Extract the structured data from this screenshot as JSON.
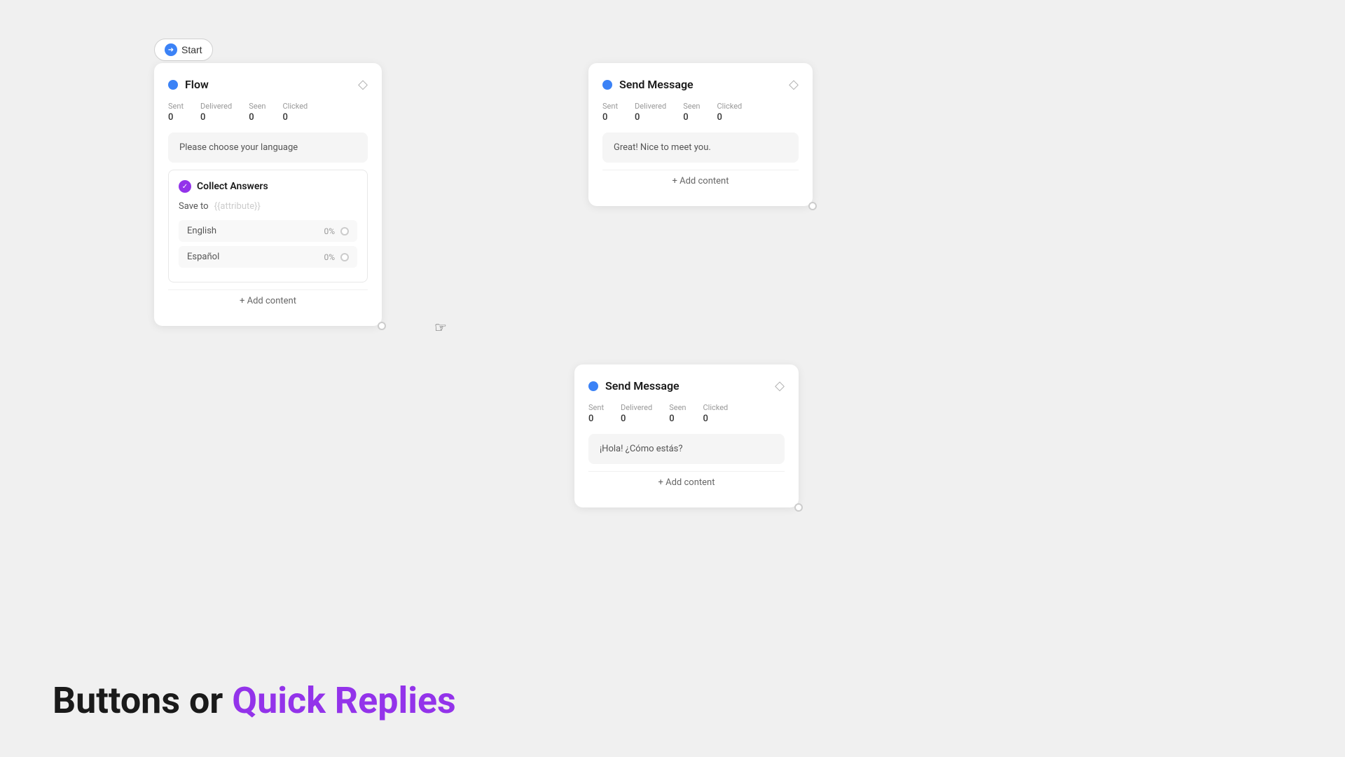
{
  "start_button": {
    "label": "Start"
  },
  "flow_card": {
    "title": "Flow",
    "stats": {
      "sent_label": "Sent",
      "sent_value": "0",
      "delivered_label": "Delivered",
      "delivered_value": "0",
      "seen_label": "Seen",
      "seen_value": "0",
      "clicked_label": "Clicked",
      "clicked_value": "0"
    },
    "message": "Please choose your language",
    "collect_answers": {
      "title": "Collect Answers",
      "save_to_label": "Save to",
      "attribute_placeholder": "{{attribute}}",
      "options": [
        {
          "label": "English",
          "percent": "0%"
        },
        {
          "label": "Español",
          "percent": "0%"
        }
      ]
    },
    "add_content": "+ Add content"
  },
  "send_message_card_1": {
    "title": "Send Message",
    "stats": {
      "sent_label": "Sent",
      "sent_value": "0",
      "delivered_label": "Delivered",
      "delivered_value": "0",
      "seen_label": "Seen",
      "seen_value": "0",
      "clicked_label": "Clicked",
      "clicked_value": "0"
    },
    "message": "Great! Nice to meet you.",
    "add_content": "+ Add content"
  },
  "send_message_card_2": {
    "title": "Send Message",
    "stats": {
      "sent_label": "Sent",
      "sent_value": "0",
      "delivered_label": "Delivered",
      "delivered_value": "0",
      "seen_label": "Seen",
      "seen_value": "0",
      "clicked_label": "Clicked",
      "clicked_value": "0"
    },
    "message": "¡Hola! ¿Cómo estás?",
    "add_content": "+ Add content"
  },
  "bottom_text": {
    "part1": "Buttons or ",
    "part2": "Quick Replies"
  }
}
